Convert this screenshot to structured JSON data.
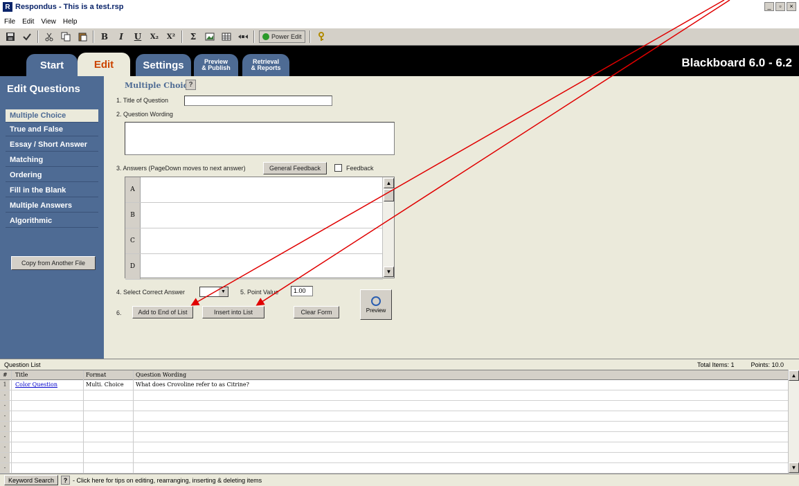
{
  "window": {
    "title": "Respondus - This is a test.rsp",
    "app_icon": "R",
    "buttons": [
      "_",
      "▫",
      "×"
    ]
  },
  "menu": [
    "File",
    "Edit",
    "View",
    "Help"
  ],
  "toolbar": {
    "icons": [
      "save-icon",
      "spell-check-icon",
      "cut-icon",
      "copy-icon",
      "paste-icon",
      "bold-icon",
      "italic-icon",
      "underline-icon",
      "subscript-icon",
      "superscript-icon",
      "equation-icon",
      "image-icon",
      "table-icon",
      "media-icon",
      "power-edit-icon",
      "key-icon"
    ],
    "bold": "B",
    "italic": "I",
    "underline": "U",
    "subscript": "X₂",
    "superscript": "X²",
    "equation": "Σ",
    "power_edit": "Power Edit",
    "key": "?"
  },
  "tabs": {
    "start": "Start",
    "edit": "Edit",
    "settings": "Settings",
    "preview_line1": "Preview",
    "preview_line2": "& Publish",
    "retrieval_line1": "Retrieval",
    "retrieval_line2": "& Reports",
    "lms": "Blackboard 6.0 - 6.2"
  },
  "sidebar": {
    "title": "Edit Questions",
    "items": [
      {
        "label": "Multiple Choice",
        "active": true
      },
      {
        "label": "True and False"
      },
      {
        "label": "Essay / Short Answer"
      },
      {
        "label": "Matching"
      },
      {
        "label": "Ordering"
      },
      {
        "label": "Fill in the Blank"
      },
      {
        "label": "Multiple Answers"
      },
      {
        "label": "Algorithmic"
      }
    ],
    "copy_button": "Copy from Another File"
  },
  "form": {
    "heading": "Multiple Choice",
    "help": "?",
    "title_label": "1. Title of Question",
    "title_value": "",
    "wording_label": "2. Question Wording",
    "answers_label": "3. Answers (PageDown moves to next answer)",
    "general_feedback": "General Feedback",
    "feedback_label": "Feedback",
    "answers": [
      "A",
      "B",
      "C",
      "D"
    ],
    "select_correct_label": "4. Select Correct Answer",
    "point_value_label": "5. Point Value",
    "point_value": "1.00",
    "step6": "6.",
    "add_to_end": "Add to End of List",
    "insert_into": "Insert into List",
    "clear_form": "Clear Form",
    "preview": "Preview"
  },
  "question_list": {
    "label": "Question List",
    "total_items": "Total Items: 1",
    "points": "Points: 10.0",
    "columns": [
      "#",
      "Title",
      "Format",
      "Question Wording"
    ],
    "rows": [
      {
        "num": "1",
        "title": "Color Question",
        "format": "Multi. Choice",
        "wording": "What does Crovoline refer to as Citrine?"
      },
      {
        "num": "-",
        "title": "",
        "format": "",
        "wording": ""
      },
      {
        "num": "-",
        "title": "",
        "format": "",
        "wording": ""
      },
      {
        "num": "-",
        "title": "",
        "format": "",
        "wording": ""
      },
      {
        "num": "-",
        "title": "",
        "format": "",
        "wording": ""
      },
      {
        "num": "-",
        "title": "",
        "format": "",
        "wording": ""
      },
      {
        "num": "-",
        "title": "",
        "format": "",
        "wording": ""
      },
      {
        "num": "-",
        "title": "",
        "format": "",
        "wording": ""
      },
      {
        "num": "-",
        "title": "",
        "format": "",
        "wording": ""
      }
    ]
  },
  "status": {
    "keyword_search": "Keyword Search",
    "help": "?",
    "tip": "- Click here for tips on editing, rearranging, inserting & deleting items"
  },
  "colors": {
    "accent": "#4e6b94",
    "panel": "#ebeadb",
    "tab_active_text": "#cc4400",
    "arrow": "#e00000"
  }
}
